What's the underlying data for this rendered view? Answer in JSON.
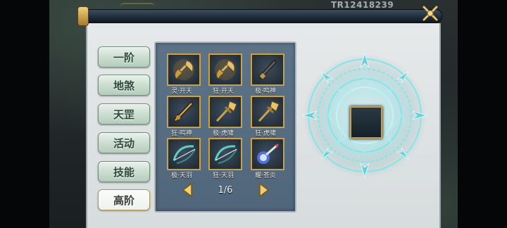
{
  "watermark": "TR12418239",
  "tabs": [
    {
      "label": "一阶",
      "active": false
    },
    {
      "label": "地煞",
      "active": false
    },
    {
      "label": "天罡",
      "active": false
    },
    {
      "label": "活动",
      "active": false
    },
    {
      "label": "技能",
      "active": false
    },
    {
      "label": "高阶",
      "active": true
    }
  ],
  "items": [
    {
      "label": "灵·开天",
      "icon": "axe-icon"
    },
    {
      "label": "狂·开天",
      "icon": "axe-icon"
    },
    {
      "label": "极·鸣神",
      "icon": "blade-icon"
    },
    {
      "label": "狂·鸣神",
      "icon": "blade-icon"
    },
    {
      "label": "极·虎啸",
      "icon": "halberd-icon"
    },
    {
      "label": "狂·虎啸",
      "icon": "halberd-icon"
    },
    {
      "label": "极·天羽",
      "icon": "bow-icon"
    },
    {
      "label": "狂·天羽",
      "icon": "bow-icon"
    },
    {
      "label": "耀·苍炎",
      "icon": "orb-staff-icon"
    }
  ],
  "pager": {
    "text": "1/6"
  },
  "colors": {
    "slot_border": "#c4a254",
    "grid_bg": "#5d7488",
    "mandala_glow": "#7fe6ea"
  }
}
